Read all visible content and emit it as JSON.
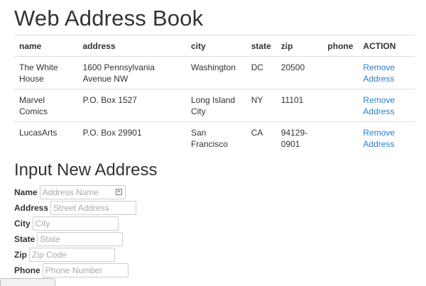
{
  "page": {
    "title": "Web Address Book",
    "form_title": "Input New Address"
  },
  "table": {
    "headers": [
      "name",
      "address",
      "city",
      "state",
      "zip",
      "phone",
      "ACTION"
    ],
    "rows": [
      {
        "name": "The White House",
        "address": "1600 Pennsylvania Avenue NW",
        "city": "Washington",
        "state": "DC",
        "zip": "20500",
        "phone": "",
        "action": "Remove Address"
      },
      {
        "name": "Marvel Comics",
        "address": "P.O. Box 1527",
        "city": "Long Island City",
        "state": "NY",
        "zip": "11101",
        "phone": "",
        "action": "Remove Address"
      },
      {
        "name": "LucasArts",
        "address": "P.O. Box 29901",
        "city": "San Francisco",
        "state": "CA",
        "zip": "94129-0901",
        "phone": "",
        "action": "Remove Address"
      }
    ]
  },
  "form": {
    "name": {
      "label": "Name",
      "placeholder": "Address Name",
      "value": ""
    },
    "address": {
      "label": "Address",
      "placeholder": "Street Address",
      "value": ""
    },
    "city": {
      "label": "City",
      "placeholder": "City",
      "value": ""
    },
    "state": {
      "label": "State",
      "placeholder": "State",
      "value": ""
    },
    "zip": {
      "label": "Zip",
      "placeholder": "Zip Code",
      "value": ""
    },
    "phone": {
      "label": "Phone",
      "placeholder": "Phone Number",
      "value": ""
    }
  },
  "colors": {
    "link": "#2a7fc6",
    "text": "#333333",
    "border": "#dddddd"
  },
  "icons": {
    "name_field_icon": "keyboard-icon"
  }
}
